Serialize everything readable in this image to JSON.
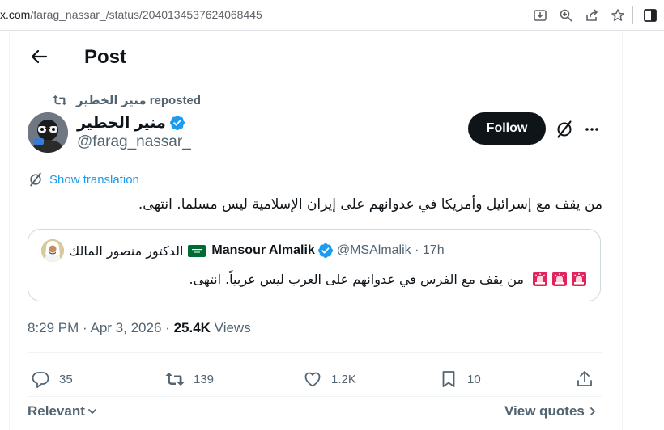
{
  "browser": {
    "url_prefix": "x.com",
    "url_path": "/farag_nassar_/status/2040134537624068445"
  },
  "header": {
    "title": "Post"
  },
  "repost": {
    "name": "منير الخطير",
    "label": "reposted"
  },
  "author": {
    "name": "منير الخطير",
    "handle": "@farag_nassar_",
    "follow_label": "Follow"
  },
  "translate": {
    "label": "Show translation"
  },
  "post": {
    "text": "من يقف مع إسرائيل وأمريكا في عدوانهم على إيران الإسلامية ليس مسلما. انتهى."
  },
  "quote": {
    "arabic_name": "الدكتور منصور المالك",
    "name": "Mansour Almalik",
    "handle": "@MSAlmalik",
    "separator": "·",
    "time": "17h",
    "text": "من يقف مع الفرس في عدوانهم على العرب ليس عربياً. انتهى.",
    "flag_label": "Saudi Arabia flag"
  },
  "meta": {
    "time": "8:29 PM",
    "separator": "·",
    "date": "Apr 3, 2026",
    "views_count": "25.4K",
    "views_label": "Views"
  },
  "actions": {
    "replies": "35",
    "reposts": "139",
    "likes": "1.2K",
    "bookmarks": "10"
  },
  "footer": {
    "sort_label": "Relevant",
    "view_quotes_label": "View quotes"
  },
  "colors": {
    "accent": "#1d9bf0",
    "text": "#0f1419",
    "muted": "#536471",
    "border": "#cfd9de",
    "follow_bg": "#0f1419",
    "verified": "#1d9bf0",
    "saudi_green": "#006c35",
    "siren_red": "#e0245e"
  }
}
